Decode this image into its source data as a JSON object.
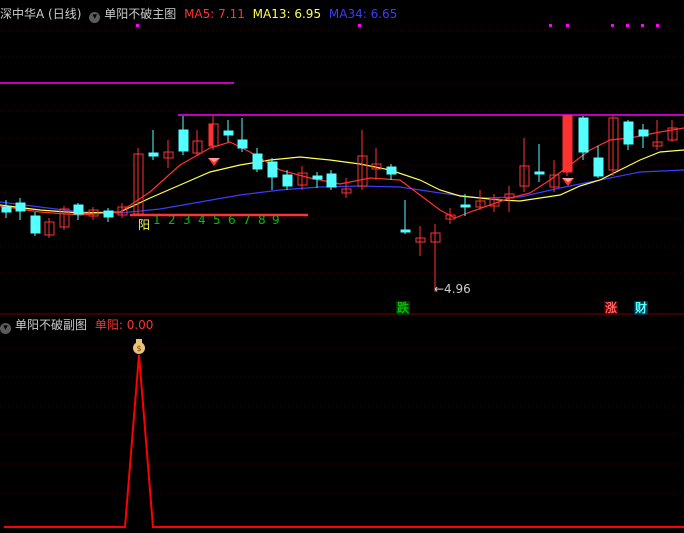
{
  "main_header": {
    "symbol": "深中华A (日线)",
    "indicator": "单阳不破主图",
    "ma5": "MA5: 7.11",
    "ma13": "MA13: 6.95",
    "ma34": "MA34: 6.65"
  },
  "colors": {
    "up": "#ff3232",
    "down": "#54ffff",
    "ma5": "#ff3232",
    "ma13": "#ffff54",
    "ma34": "#3c3cff",
    "level": "#ff00ff",
    "grid": "#3a0000"
  },
  "yang_label": "阳",
  "yang_counts": [
    "1",
    "2",
    "3",
    "4",
    "5",
    "6",
    "7",
    "8",
    "9"
  ],
  "low_label": "←4.96",
  "markers": {
    "die": "跌",
    "zhang": "涨",
    "cai": "财"
  },
  "sub_header": {
    "indicator": "单阳不破副图",
    "value": "单阳: 0.00"
  },
  "icons": [
    "chevron-down-icon",
    "diamond-icon",
    "money-bag-icon"
  ]
}
